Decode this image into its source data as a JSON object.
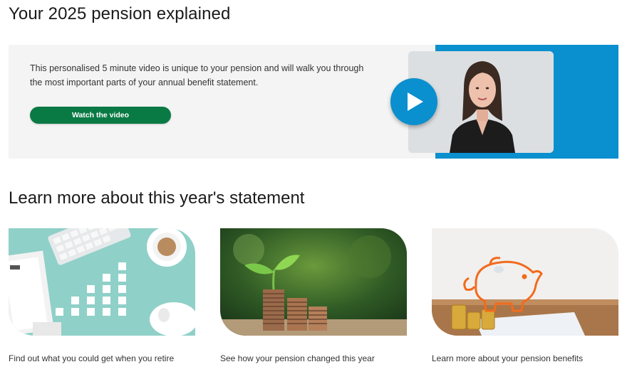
{
  "page": {
    "title": "Your 2025 pension explained"
  },
  "video": {
    "description": "This personalised 5 minute video is unique to your pension and will walk you through the most important parts of your annual benefit statement.",
    "button_label": "Watch the video"
  },
  "learn": {
    "heading": "Learn more about this year's statement",
    "cards": [
      {
        "caption": "Find out what you could get when you retire",
        "icon": "desk-calculator-image"
      },
      {
        "caption": "See how your pension changed this year",
        "icon": "coins-seedling-image"
      },
      {
        "caption": "Learn more about your pension benefits",
        "icon": "piggy-bank-image"
      }
    ]
  },
  "colors": {
    "accent_blue": "#0a8fcf",
    "button_green": "#0a7a44",
    "panel_bg": "#f4f4f4"
  }
}
